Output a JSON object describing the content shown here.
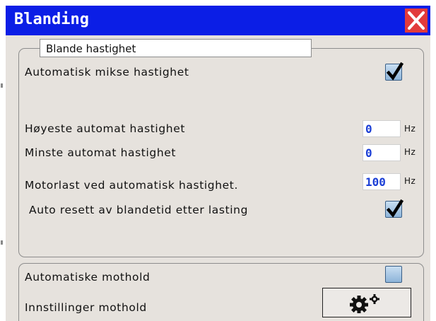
{
  "window": {
    "title": "Blanding"
  },
  "group_speed": {
    "title": "Blande hastighet",
    "auto_mix_label": "Automatisk mikse hastighet",
    "auto_mix_checked": true,
    "max_speed": {
      "label": "Høyeste automat hastighet",
      "value": "0",
      "unit": "Hz"
    },
    "min_speed": {
      "label": "Minste automat hastighet",
      "value": "0",
      "unit": "Hz"
    },
    "motor_load": {
      "label": "Motorlast ved automatisk hastighet.",
      "value": "100",
      "unit": "Hz"
    },
    "auto_reset_label": "Auto resett av blandetid etter lasting",
    "auto_reset_checked": true
  },
  "group_counter": {
    "auto_counterhold_label": "Automatiske mothold",
    "auto_counterhold_checked": false,
    "settings_label": "Innstillinger mothold"
  },
  "icons": {
    "close": "close-icon",
    "settings": "gears-icon",
    "check": "checkmark-icon"
  },
  "colors": {
    "titlebar": "#0b1ee6",
    "close_button": "#e23b3b",
    "panel_bg": "#e6e2dd",
    "value_text": "#1c3fd6"
  }
}
